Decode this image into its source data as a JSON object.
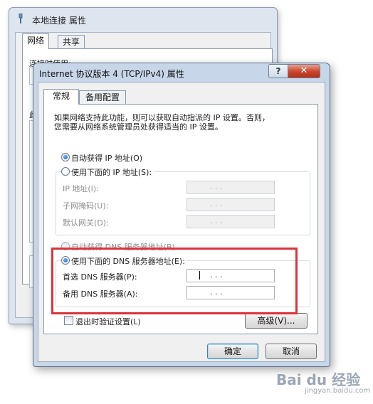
{
  "bg_window": {
    "title": "本地连接 属性",
    "tabs": [
      "网络",
      "共享"
    ],
    "fragments": [
      "连接时使用:",
      "此"
    ]
  },
  "dialog": {
    "title": "Internet 协议版本 4 (TCP/IPv4) 属性",
    "help_label": "?",
    "close_label": "✕",
    "tabs": {
      "general": "常规",
      "alternate": "备用配置"
    },
    "description_line1": "如果网络支持此功能，则可以获取自动指派的 IP 设置。否则，",
    "description_line2": "您需要从网络系统管理员处获得适当的 IP 设置。",
    "ip": {
      "auto_label": "自动获得 IP 地址(O)",
      "manual_label": "使用下面的 IP 地址(S):",
      "address_label": "IP 地址(I):",
      "mask_label": "子网掩码(U):",
      "gateway_label": "默认网关(D):",
      "selected": "auto"
    },
    "dns": {
      "auto_label": "自动获得 DNS 服务器地址(B)",
      "manual_label": "使用下面的 DNS 服务器地址(E):",
      "preferred_label": "首选 DNS 服务器(P):",
      "alternate_label": "备用 DNS 服务器(A):",
      "selected": "manual"
    },
    "ip_dots": ".        .        .",
    "validate_label": "退出时验证设置(L)",
    "advanced_label": "高级(V)...",
    "ok_label": "确定",
    "cancel_label": "取消"
  },
  "watermark": {
    "main": "Bai du 经验",
    "sub": "jingyan.baidu.com"
  },
  "colors": {
    "highlight": "#d9343c",
    "title_bar": "#c7d6e8",
    "close_button": "#c8442b"
  }
}
